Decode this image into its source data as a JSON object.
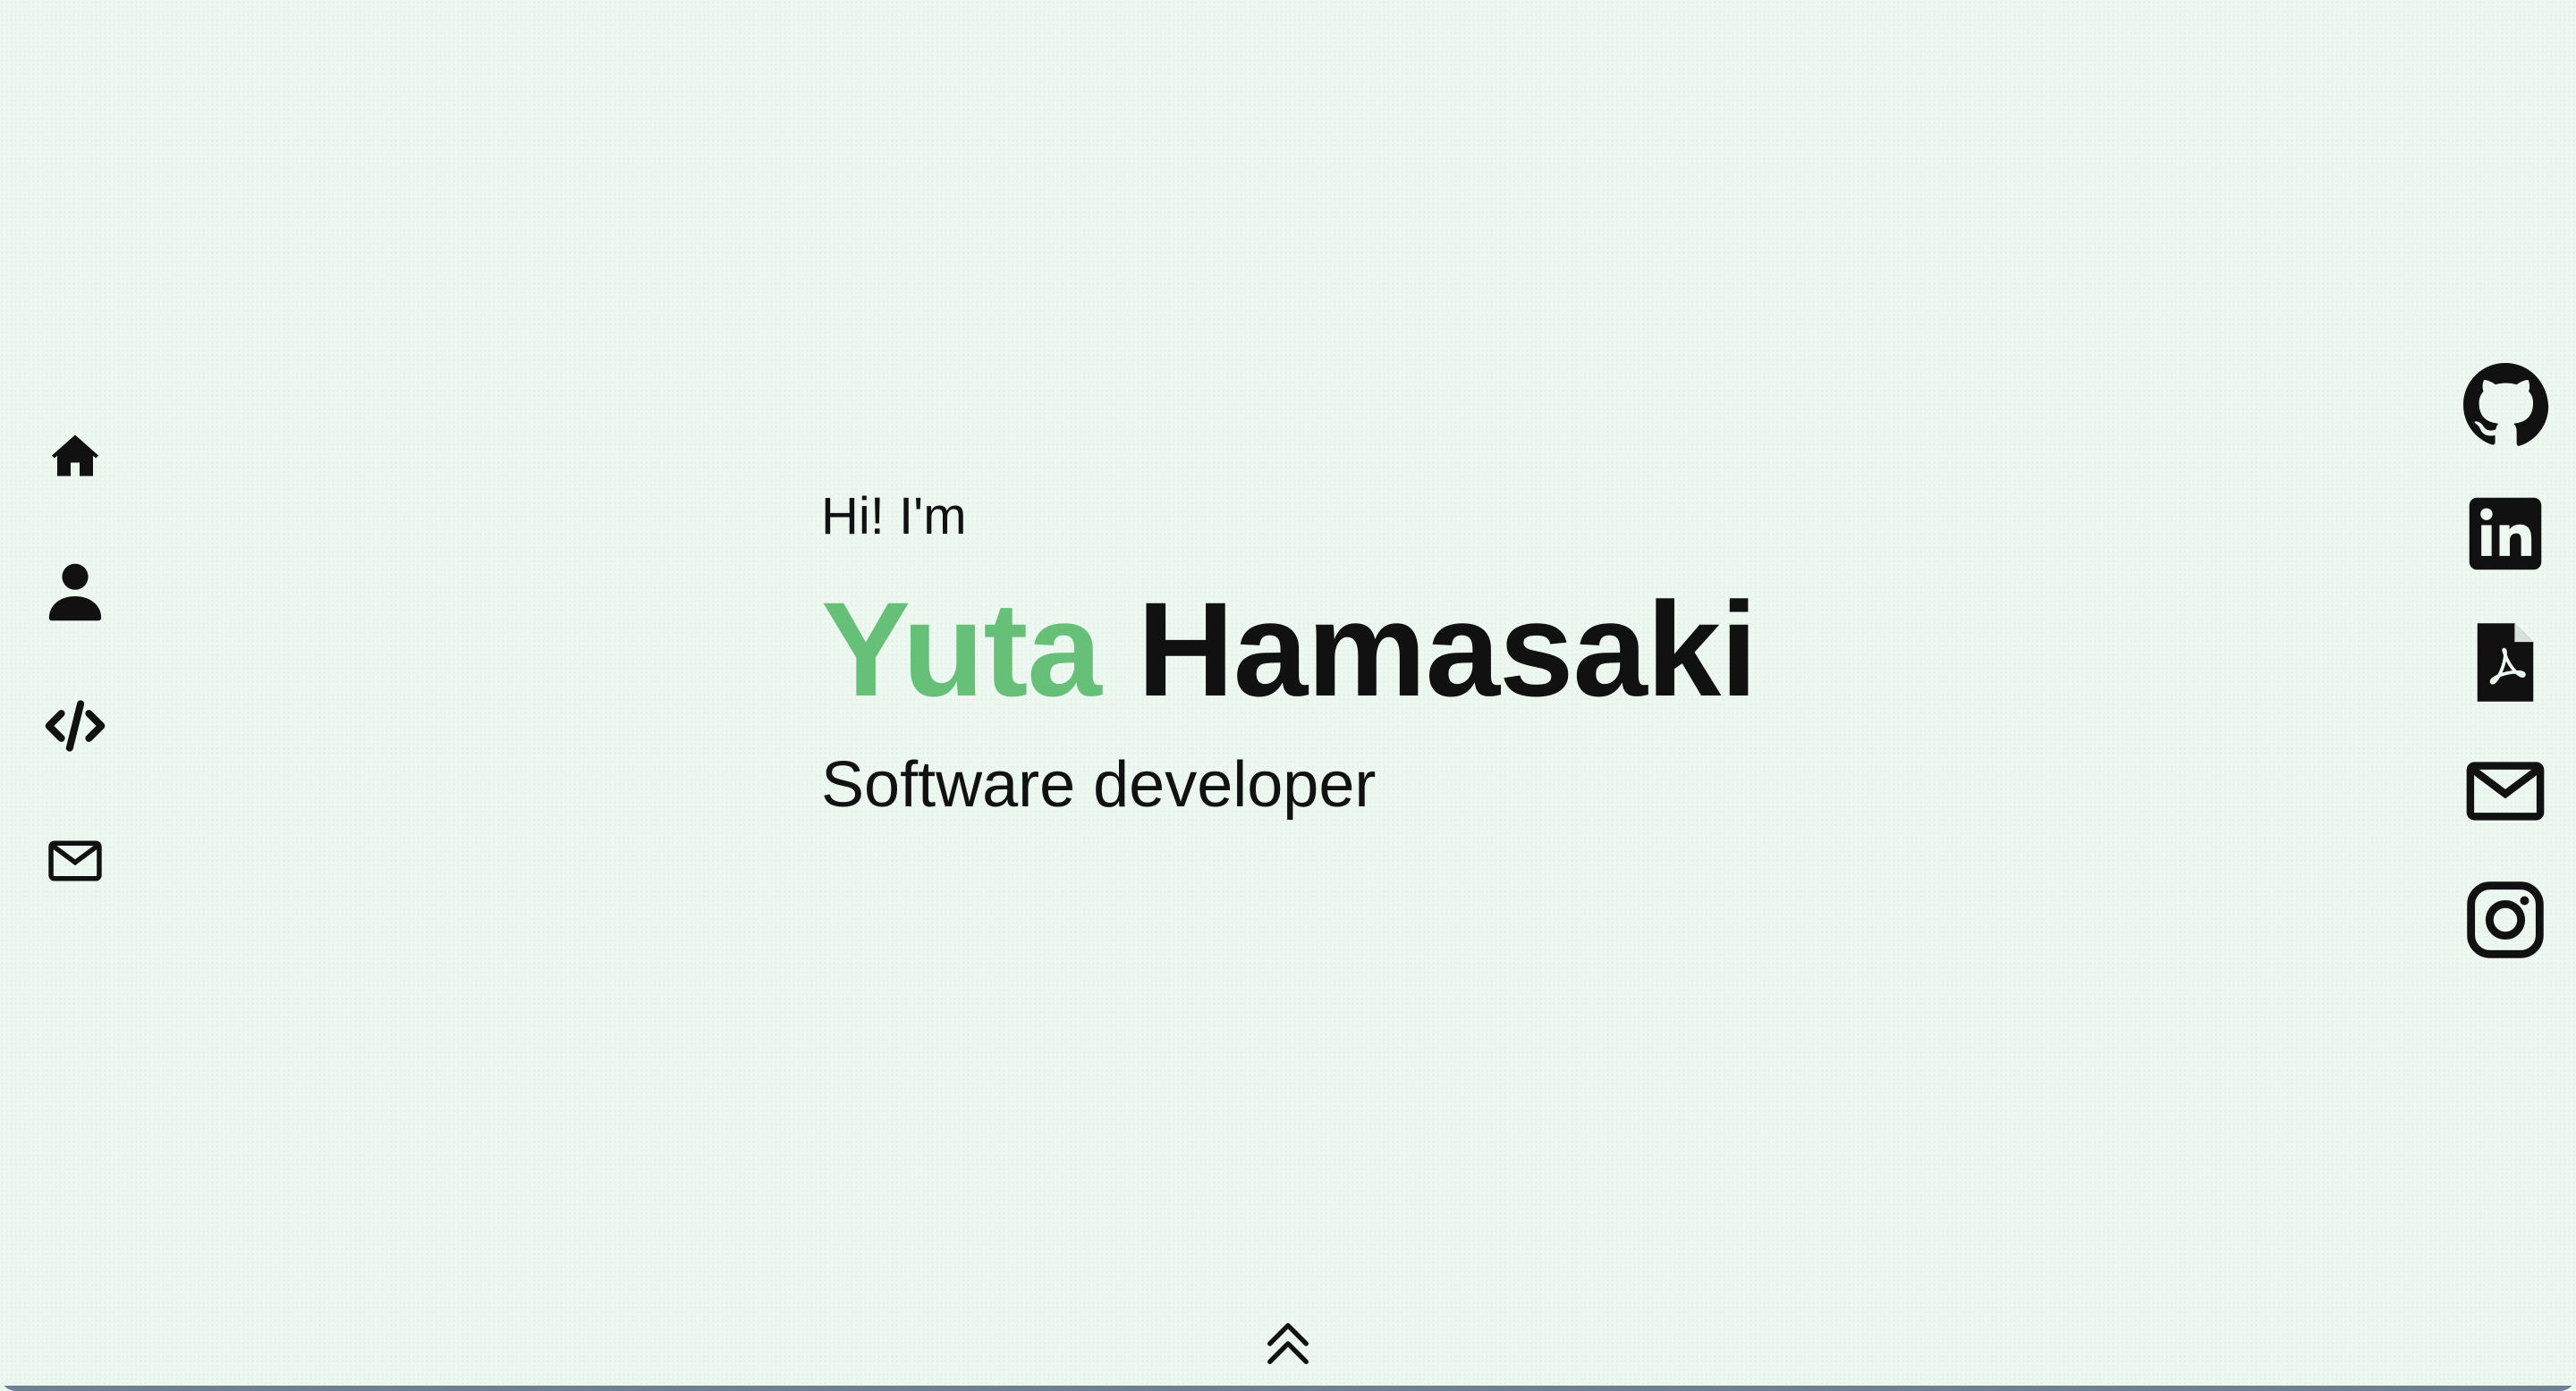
{
  "nav": {
    "items": [
      {
        "name": "home",
        "icon": "home-icon"
      },
      {
        "name": "about",
        "icon": "person-icon"
      },
      {
        "name": "projects",
        "icon": "code-icon"
      },
      {
        "name": "contact",
        "icon": "mail-icon"
      }
    ]
  },
  "social": {
    "items": [
      {
        "name": "github",
        "icon": "github-icon"
      },
      {
        "name": "linkedin",
        "icon": "linkedin-icon"
      },
      {
        "name": "resume",
        "icon": "pdf-file-icon"
      },
      {
        "name": "email",
        "icon": "mail-icon"
      },
      {
        "name": "instagram",
        "icon": "instagram-icon"
      }
    ]
  },
  "hero": {
    "greeting": "Hi! I'm",
    "first_name": "Yuta",
    "last_name": "Hamasaki",
    "role": "Software developer"
  },
  "scroll": {
    "icon": "double-chevron-up-icon"
  },
  "colors": {
    "background": "#edf8f0",
    "accent": "#66c077",
    "text": "#111111"
  }
}
